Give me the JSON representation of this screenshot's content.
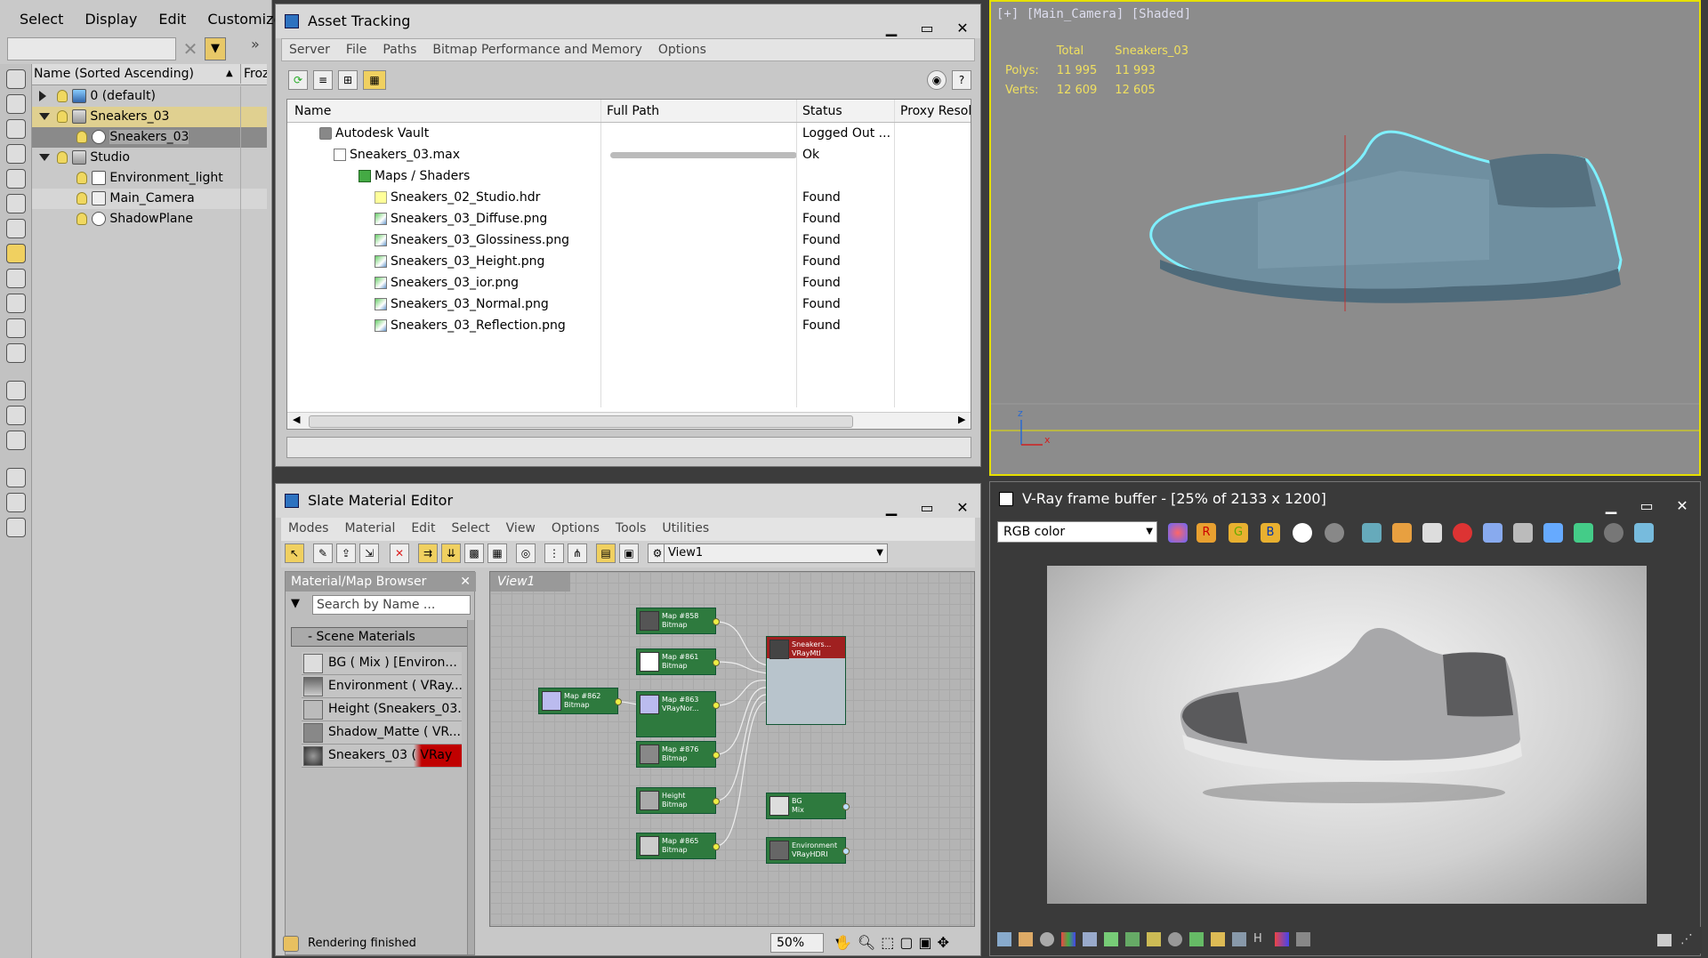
{
  "scene_explorer": {
    "menu": [
      "Select",
      "Display",
      "Edit",
      "Customize"
    ],
    "header": {
      "name_col": "Name (Sorted Ascending)",
      "froz_col": "Froz"
    },
    "items": [
      {
        "label": "0 (default)"
      },
      {
        "label": "Sneakers_03"
      },
      {
        "label": "Sneakers_03"
      },
      {
        "label": "Studio"
      },
      {
        "label": "Environment_light"
      },
      {
        "label": "Main_Camera"
      },
      {
        "label": "ShadowPlane"
      }
    ]
  },
  "asset_tracking": {
    "title": "Asset Tracking",
    "menu": [
      "Server",
      "File",
      "Paths",
      "Bitmap Performance and Memory",
      "Options"
    ],
    "columns": [
      "Name",
      "Full Path",
      "Status",
      "Proxy Resol."
    ],
    "rows": [
      {
        "name": "Autodesk Vault",
        "status": "Logged Out ..."
      },
      {
        "name": "Sneakers_03.max",
        "status": "Ok"
      },
      {
        "name": "Maps / Shaders",
        "status": ""
      },
      {
        "name": "Sneakers_02_Studio.hdr",
        "status": "Found"
      },
      {
        "name": "Sneakers_03_Diffuse.png",
        "status": "Found"
      },
      {
        "name": "Sneakers_03_Glossiness.png",
        "status": "Found"
      },
      {
        "name": "Sneakers_03_Height.png",
        "status": "Found"
      },
      {
        "name": "Sneakers_03_ior.png",
        "status": "Found"
      },
      {
        "name": "Sneakers_03_Normal.png",
        "status": "Found"
      },
      {
        "name": "Sneakers_03_Reflection.png",
        "status": "Found"
      }
    ]
  },
  "viewport": {
    "label": "[+] [Main_Camera] [Shaded]",
    "stats": {
      "col_total": "Total",
      "col_obj": "Sneakers_03",
      "polys_label": "Polys:",
      "polys_total": "11 995",
      "polys_obj": "11 993",
      "verts_label": "Verts:",
      "verts_total": "12 609",
      "verts_obj": "12 605"
    },
    "axis_z": "z",
    "axis_x": "x",
    "highlight_color": "#e6e000"
  },
  "slate": {
    "title": "Slate Material Editor",
    "menu": [
      "Modes",
      "Material",
      "Edit",
      "Select",
      "View",
      "Options",
      "Tools",
      "Utilities"
    ],
    "view_select": "View1",
    "browser_title": "Material/Map Browser",
    "search_placeholder": "Search by Name ...",
    "group": "- Scene Materials",
    "materials": [
      "BG  ( Mix )  [Environ...",
      "Environment  ( VRay...",
      "Height (Sneakers_03...",
      "Shadow_Matte  ( VR...",
      "Sneakers_03  ( VRay"
    ],
    "view_tab": "View1",
    "nodes": [
      {
        "title": "Map #858",
        "sub": "Bitmap"
      },
      {
        "title": "Map #861",
        "sub": "Bitmap"
      },
      {
        "title": "Map #863",
        "sub": "VRayNor..."
      },
      {
        "title": "Map #862",
        "sub": "Bitmap"
      },
      {
        "title": "Map #876",
        "sub": "Bitmap"
      },
      {
        "title": "Height",
        "sub": "Bitmap"
      },
      {
        "title": "Map #865",
        "sub": "Bitmap"
      },
      {
        "title": "Sneakers...",
        "sub": "VRayMtl"
      },
      {
        "title": "BG",
        "sub": "Mix"
      },
      {
        "title": "Environment",
        "sub": "VRayHDRI"
      }
    ],
    "status": "Rendering finished",
    "zoom": "50%"
  },
  "vfb": {
    "title": "V-Ray frame buffer - [25% of 2133 x 1200]",
    "channel": "RGB color"
  }
}
